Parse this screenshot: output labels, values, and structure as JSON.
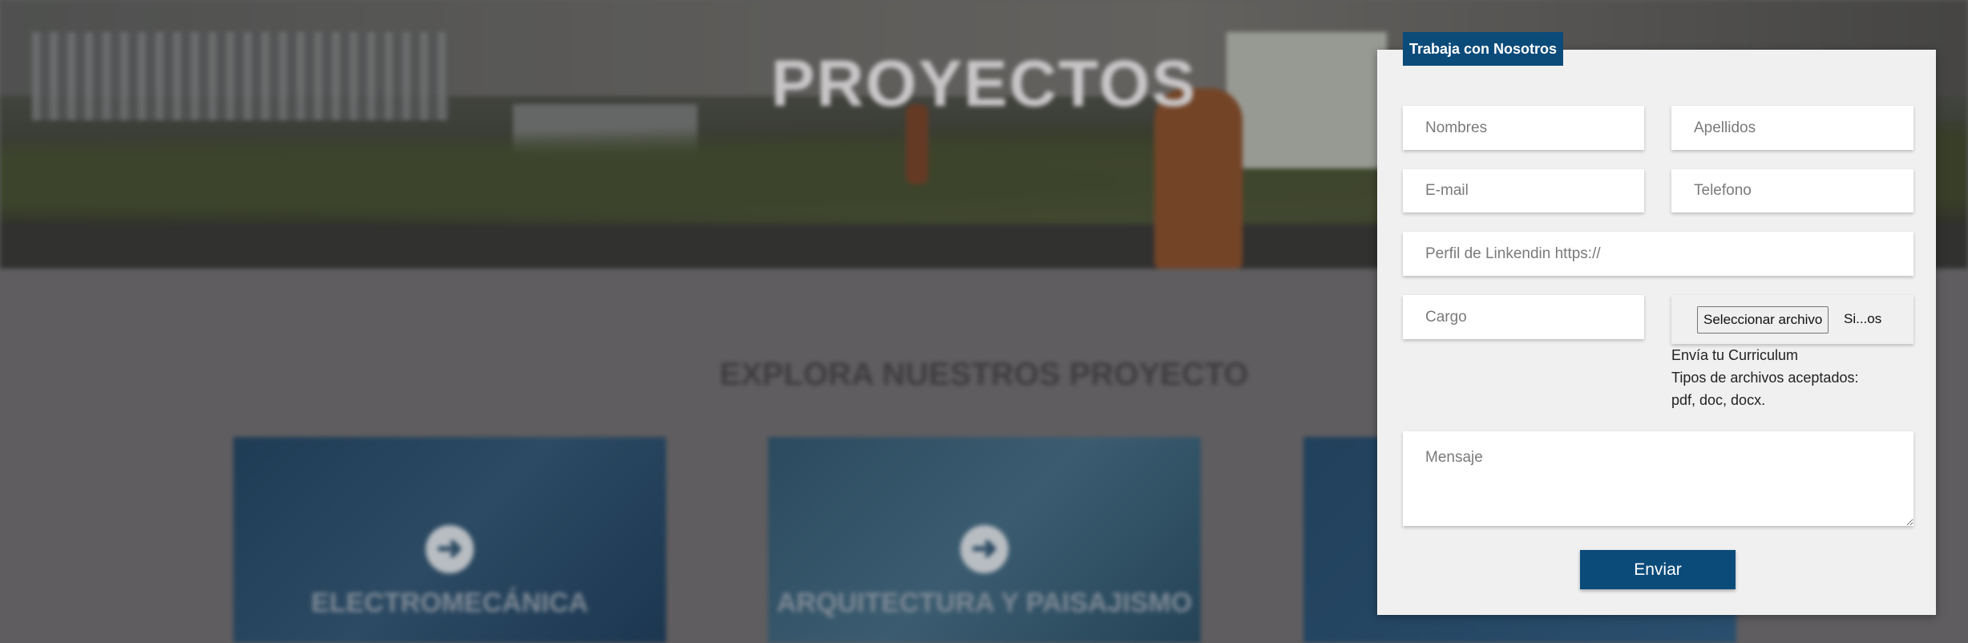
{
  "background": {
    "hero_title": "PROYECTOS",
    "section_title": "EXPLORA NUESTROS PROYECTO",
    "cards": [
      {
        "label": "ELECTROMECÁNICA",
        "icon": "arrow-right-circle-icon"
      },
      {
        "label": "ARQUITECTURA Y PAISAJISMO",
        "icon": "arrow-right-circle-icon"
      },
      {
        "label": "",
        "icon": ""
      }
    ]
  },
  "form": {
    "tab_title": "Trabaja con Nosotros",
    "fields": {
      "nombres": {
        "placeholder": "Nombres",
        "value": ""
      },
      "apellidos": {
        "placeholder": "Apellidos",
        "value": ""
      },
      "email": {
        "placeholder": "E-mail",
        "value": ""
      },
      "telefono": {
        "placeholder": "Telefono",
        "value": ""
      },
      "linkedin": {
        "placeholder": "Perfil de Linkendin https://",
        "value": ""
      },
      "cargo": {
        "placeholder": "Cargo",
        "value": ""
      },
      "mensaje": {
        "placeholder": "Mensaje",
        "value": ""
      }
    },
    "file": {
      "button_label": "Seleccionar archivo",
      "file_name": "Si...os"
    },
    "hints": [
      "Envía tu Curriculum",
      "Tipos de archivos aceptados:",
      "pdf, doc, docx."
    ],
    "submit_label": "Enviar",
    "colors": {
      "accent": "#0b4b7a",
      "panel": "#f0f0f0"
    }
  }
}
